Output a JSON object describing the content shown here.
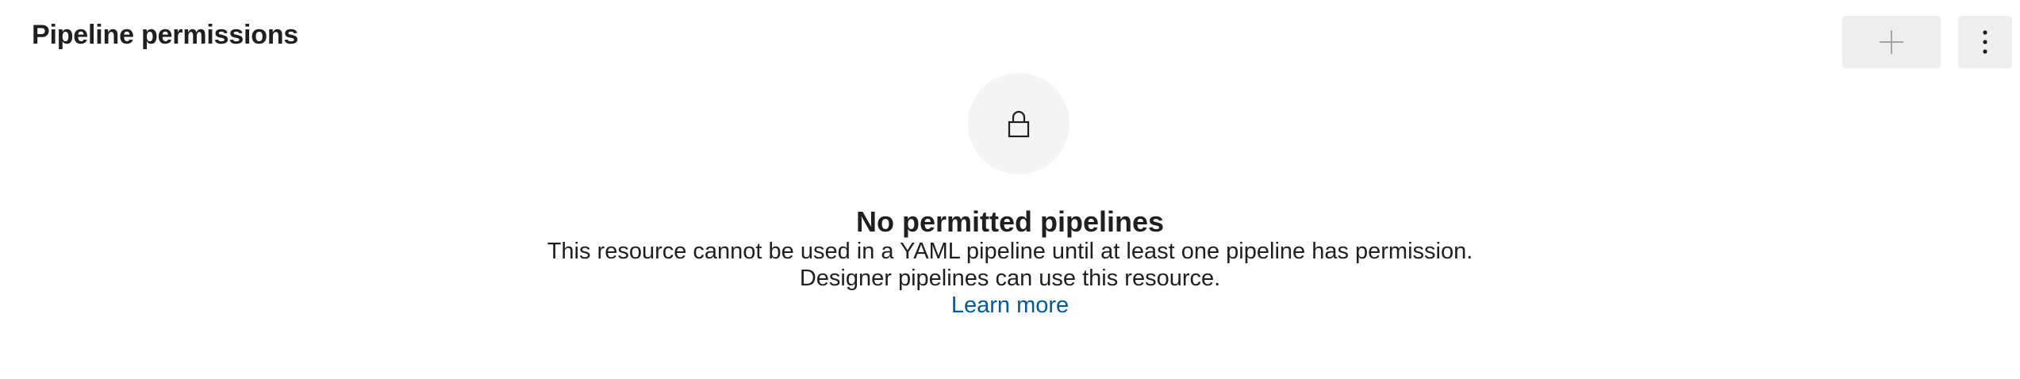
{
  "header": {
    "title": "Pipeline permissions"
  },
  "toolbar": {
    "add_icon": "plus-icon",
    "more_icon": "more-vertical-icon"
  },
  "empty_state": {
    "icon": "lock-icon",
    "title": "No permitted pipelines",
    "line1": "This resource cannot be used in a YAML pipeline until at least one pipeline has permission.",
    "line2": "Designer pipelines can use this resource.",
    "link_label": "Learn more"
  },
  "colors": {
    "link": "#005a9e",
    "button_bg": "#eeeeee",
    "circle_bg": "#f4f4f4",
    "text": "#201f1e"
  }
}
